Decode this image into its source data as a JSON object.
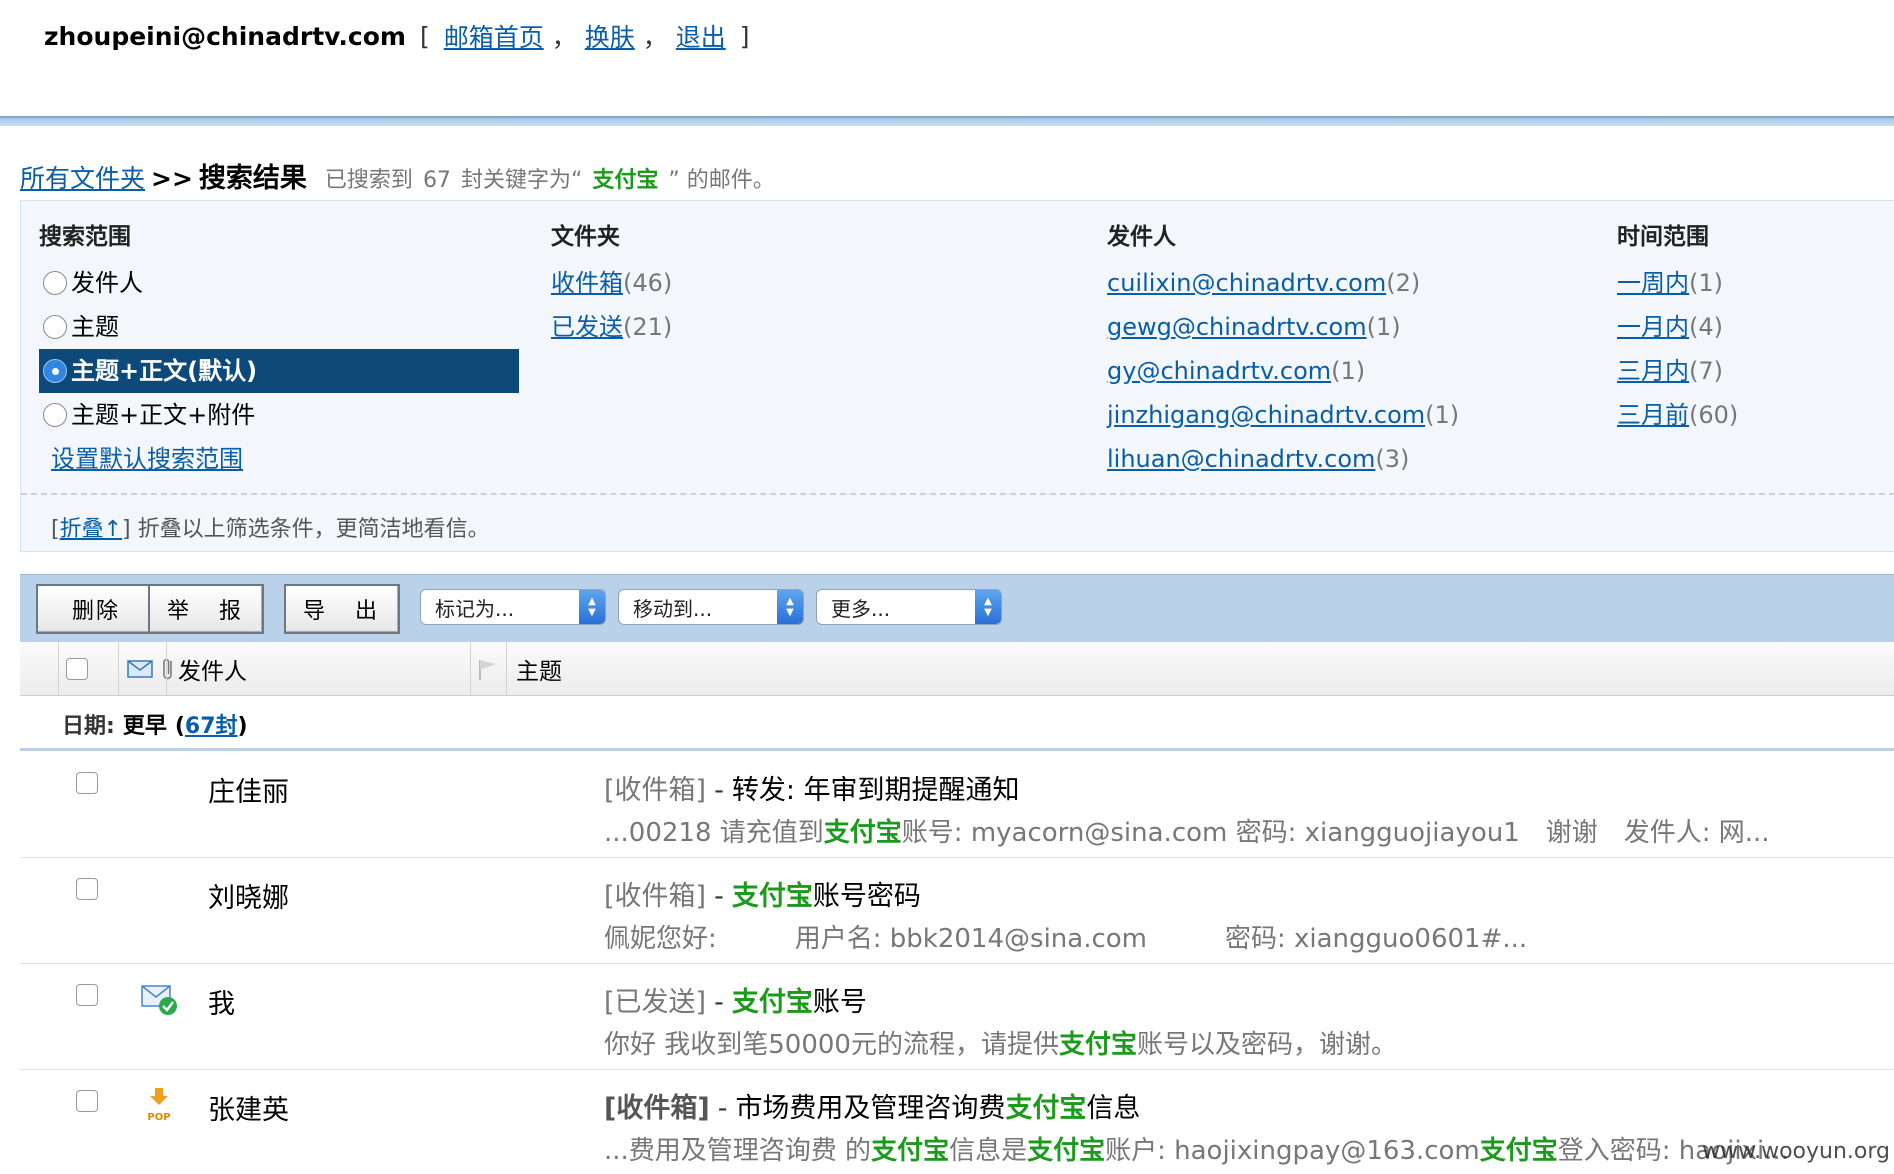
{
  "top": {
    "account": "zhoupeini@chinadrtv.com",
    "bracket_open": "[",
    "bracket_close": "]",
    "links": [
      "邮箱首页",
      "换肤",
      "退出"
    ],
    "separator": "，"
  },
  "breadcrumb": {
    "root": "所有文件夹",
    "arrow": ">>",
    "current": "搜索结果",
    "summary_prefix": "已搜索到",
    "count": "67",
    "summary_mid": "封关键字为“",
    "keyword": "支付宝",
    "summary_suffix": "” 的邮件。"
  },
  "filter": {
    "scope": {
      "header": "搜索范围",
      "options": [
        "发件人",
        "主题",
        "主题+正文(默认)",
        "主题+正文+附件"
      ],
      "selected_index": 2,
      "set_default": "设置默认搜索范围"
    },
    "folder": {
      "header": "文件夹",
      "items": [
        {
          "label": "收件箱",
          "count": "(46)"
        },
        {
          "label": "已发送",
          "count": "(21)"
        }
      ]
    },
    "sender": {
      "header": "发件人",
      "items": [
        {
          "label": "cuilixin@chinadrtv.com",
          "count": "(2)"
        },
        {
          "label": "gewg@chinadrtv.com",
          "count": "(1)"
        },
        {
          "label": "gy@chinadrtv.com",
          "count": "(1)"
        },
        {
          "label": "jinzhigang@chinadrtv.com",
          "count": "(1)"
        },
        {
          "label": "lihuan@chinadrtv.com",
          "count": "(3)"
        }
      ]
    },
    "time": {
      "header": "时间范围",
      "items": [
        {
          "label": "一周内",
          "count": "(1)"
        },
        {
          "label": "一月内",
          "count": "(4)"
        },
        {
          "label": "三月内",
          "count": "(7)"
        },
        {
          "label": "三月前",
          "count": "(60)"
        }
      ]
    },
    "fold": {
      "open": "[",
      "link": "折叠↑",
      "close": "]",
      "text": "折叠以上筛选条件，更简洁地看信。"
    }
  },
  "toolbar": {
    "delete": "删除",
    "report": "举　报",
    "export": "导　出",
    "mark_as": "标记为...",
    "move_to": "移动到...",
    "more": "更多..."
  },
  "list_header": {
    "sender": "发件人",
    "subject": "主题"
  },
  "date_group": {
    "label": "日期:",
    "name": "更早",
    "open": "(",
    "count_link": "67封",
    "close": ")"
  },
  "mails": [
    {
      "sender": "庄佳丽",
      "folder": "[收件箱]",
      "dash": "-",
      "subject": [
        {
          "t": "转发: 年审到期提醒通知",
          "hl": false
        }
      ],
      "preview": [
        {
          "t": "...00218 请充值到",
          "hl": false
        },
        {
          "t": "支付宝",
          "hl": true
        },
        {
          "t": "账号: myacorn@sina.com 密码: xiangguojiayou1　谢谢　发件人: 网...",
          "hl": false
        }
      ],
      "icon": "none"
    },
    {
      "sender": "刘晓娜",
      "folder": "[收件箱]",
      "dash": "-",
      "subject": [
        {
          "t": "支付宝",
          "hl": true
        },
        {
          "t": "账号密码",
          "hl": false
        }
      ],
      "preview": [
        {
          "t": "佩妮您好:　　　用户名: bbk2014@sina.com　　　密码:  xiangguo0601#...",
          "hl": false
        }
      ],
      "icon": "none"
    },
    {
      "sender": "我",
      "folder": "[已发送]",
      "dash": "-",
      "subject": [
        {
          "t": "支付宝",
          "hl": true
        },
        {
          "t": "账号",
          "hl": false
        }
      ],
      "preview": [
        {
          "t": "你好 我收到笔50000元的流程，请提供",
          "hl": false
        },
        {
          "t": "支付宝",
          "hl": true
        },
        {
          "t": "账号以及密码，谢谢。",
          "hl": false
        }
      ],
      "icon": "sent-check-icon"
    },
    {
      "sender": "张建英",
      "folder": "[收件箱]",
      "dash": "-",
      "subject": [
        {
          "t": "市场费用及管理咨询费",
          "hl": false
        },
        {
          "t": "支付宝",
          "hl": true
        },
        {
          "t": "信息",
          "hl": false
        }
      ],
      "preview": [
        {
          "t": "...费用及管理咨询费 的",
          "hl": false
        },
        {
          "t": "支付宝",
          "hl": true
        },
        {
          "t": "信息是",
          "hl": false
        },
        {
          "t": "支付宝",
          "hl": true
        },
        {
          "t": "账户: haojixingpay@163.com",
          "hl": false
        },
        {
          "t": "支付宝",
          "hl": true
        },
        {
          "t": "登入密码: haojixi...",
          "hl": false
        }
      ],
      "icon": "pop-download-icon",
      "unread": true
    }
  ],
  "watermark": "www.wooyun.org",
  "colors": {
    "link": "#0a5ea8",
    "highlight": "#1b9a1b",
    "selected_bg": "#0d4a79",
    "toolbar_bg": "#b9d2ea"
  }
}
